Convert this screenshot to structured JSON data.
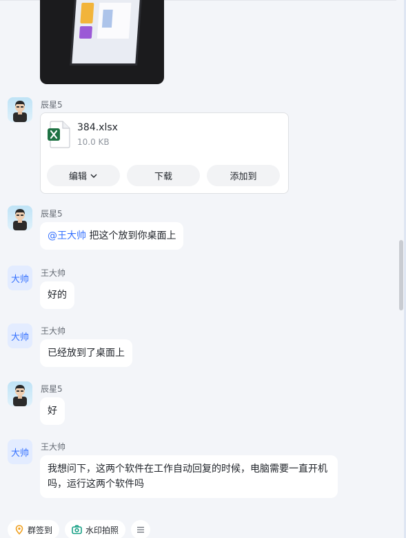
{
  "file": {
    "name": "384.xlsx",
    "size": "10.0 KB",
    "actions": {
      "edit": "编辑",
      "download": "下载",
      "add_to": "添加到"
    }
  },
  "messages": {
    "m1": {
      "sender": "辰星5"
    },
    "m2": {
      "sender": "辰星5",
      "mention": "@王大帅",
      "text": " 把这个放到你桌面上"
    },
    "m3": {
      "sender": "王大帅",
      "avatar_text": "大帅",
      "text": "好的"
    },
    "m4": {
      "sender": "王大帅",
      "avatar_text": "大帅",
      "text": "已经放到了桌面上"
    },
    "m5": {
      "sender": "辰星5",
      "text": "好"
    },
    "m6": {
      "sender": "王大帅",
      "avatar_text": "大帅",
      "line1": "我想问下，这两个软件在工作自动回复的时候，电脑需要一直开机",
      "line2": "吗，运行这两个软件吗"
    }
  },
  "toolbar": {
    "checkin": "群签到",
    "watermark_photo": "水印拍照"
  },
  "colors": {
    "accent": "#3370ff",
    "excel_green": "#1f7244",
    "checkin_orange": "#f0a020",
    "camera_green": "#16a085"
  },
  "icons": [
    "excel-file-icon",
    "chevron-down-icon",
    "location-pin-icon",
    "camera-icon",
    "menu-icon"
  ]
}
